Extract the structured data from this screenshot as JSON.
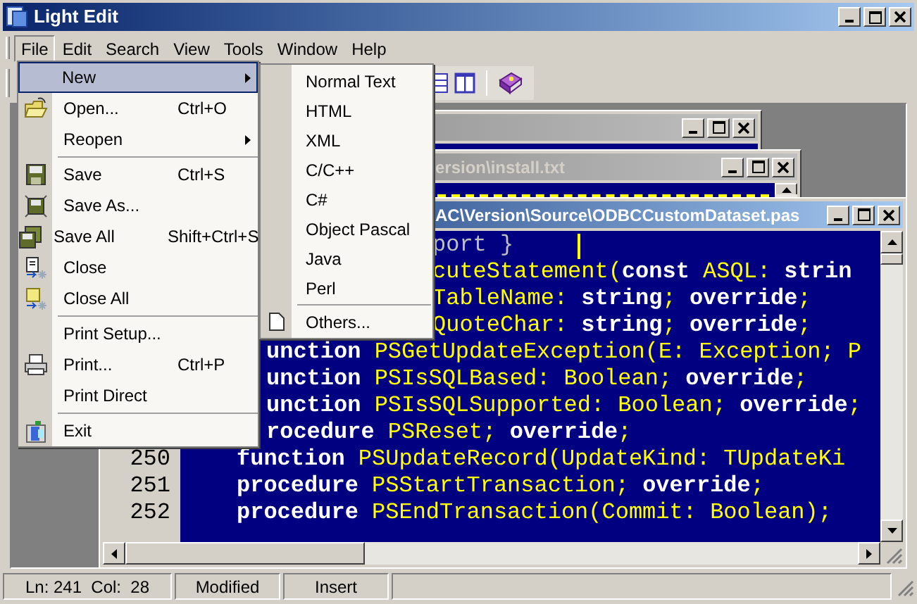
{
  "window": {
    "title": "Light Edit"
  },
  "menubar": [
    {
      "label": "File",
      "selected": true
    },
    {
      "label": "Edit",
      "selected": false
    },
    {
      "label": "Search",
      "selected": false
    },
    {
      "label": "View",
      "selected": false
    },
    {
      "label": "Tools",
      "selected": false
    },
    {
      "label": "Window",
      "selected": false
    },
    {
      "label": "Help",
      "selected": false
    }
  ],
  "file_menu": [
    {
      "kind": "item",
      "label": "New",
      "has_submenu": true,
      "selected": true
    },
    {
      "kind": "item",
      "label": "Open...",
      "shortcut": "Ctrl+O",
      "selected": false
    },
    {
      "kind": "item",
      "label": "Reopen",
      "has_submenu": true,
      "selected": false
    },
    {
      "kind": "separator"
    },
    {
      "kind": "item",
      "label": "Save",
      "shortcut": "Ctrl+S",
      "selected": false
    },
    {
      "kind": "item",
      "label": "Save As...",
      "selected": false
    },
    {
      "kind": "item",
      "label": "Save All",
      "shortcut": "Shift+Ctrl+S",
      "selected": false
    },
    {
      "kind": "item",
      "label": "Close",
      "selected": false
    },
    {
      "kind": "item",
      "label": "Close All",
      "selected": false
    },
    {
      "kind": "separator"
    },
    {
      "kind": "item",
      "label": "Print Setup...",
      "selected": false
    },
    {
      "kind": "item",
      "label": "Print...",
      "shortcut": "Ctrl+P",
      "selected": false
    },
    {
      "kind": "item",
      "label": "Print Direct",
      "selected": false
    },
    {
      "kind": "separator"
    },
    {
      "kind": "item",
      "label": "Exit",
      "selected": false
    }
  ],
  "new_submenu": [
    {
      "kind": "item",
      "label": "Normal Text"
    },
    {
      "kind": "item",
      "label": "HTML"
    },
    {
      "kind": "item",
      "label": "XML"
    },
    {
      "kind": "item",
      "label": "C/C++"
    },
    {
      "kind": "item",
      "label": "C#"
    },
    {
      "kind": "item",
      "label": "Object Pascal"
    },
    {
      "kind": "item",
      "label": "Java"
    },
    {
      "kind": "item",
      "label": "Perl"
    },
    {
      "kind": "separator"
    },
    {
      "kind": "item",
      "label": "Others..."
    }
  ],
  "documents": [
    {
      "active": false
    },
    {
      "title": "ersion\\install.txt",
      "active": false
    },
    {
      "title": "AC\\Version\\Source\\ODBCCustomDataset.pas",
      "active": true
    }
  ],
  "editor": {
    "lines": [
      {
        "segments": [
          {
            "kind": "comment",
            "text": "port }"
          }
        ]
      },
      {
        "segments": [
          {
            "kind": "ident",
            "text": "cuteStatement("
          },
          {
            "kind": "keyword",
            "text": "const"
          },
          {
            "kind": "ident",
            "text": " ASQL: "
          },
          {
            "kind": "keyword",
            "text": "strin"
          }
        ]
      },
      {
        "segments": [
          {
            "kind": "ident",
            "text": "TableName: "
          },
          {
            "kind": "keyword",
            "text": "string"
          },
          {
            "kind": "ident",
            "text": "; "
          },
          {
            "kind": "keyword",
            "text": "override"
          },
          {
            "kind": "ident",
            "text": ";"
          }
        ]
      },
      {
        "segments": [
          {
            "kind": "ident",
            "text": "QuoteChar: "
          },
          {
            "kind": "keyword",
            "text": "string"
          },
          {
            "kind": "ident",
            "text": "; "
          },
          {
            "kind": "keyword",
            "text": "override"
          },
          {
            "kind": "ident",
            "text": ";"
          }
        ]
      },
      {
        "segments": [
          {
            "kind": "keyword",
            "text": "unction"
          },
          {
            "kind": "ident",
            "text": " PSGetUpdateException(E: Exception; P"
          }
        ]
      },
      {
        "segments": [
          {
            "kind": "keyword",
            "text": "unction"
          },
          {
            "kind": "ident",
            "text": " PSIsSQLBased: Boolean; "
          },
          {
            "kind": "keyword",
            "text": "override"
          },
          {
            "kind": "ident",
            "text": ";"
          }
        ]
      },
      {
        "segments": [
          {
            "kind": "keyword",
            "text": "unction"
          },
          {
            "kind": "ident",
            "text": " PSIsSQLSupported: Boolean; "
          },
          {
            "kind": "keyword",
            "text": "override"
          },
          {
            "kind": "ident",
            "text": ";"
          }
        ]
      },
      {
        "segments": [
          {
            "kind": "keyword",
            "text": "rocedure"
          },
          {
            "kind": "ident",
            "text": " PSReset; "
          },
          {
            "kind": "keyword",
            "text": "override"
          },
          {
            "kind": "ident",
            "text": ";"
          }
        ]
      },
      {
        "number": "250",
        "segments": [
          {
            "kind": "keyword",
            "text": "function"
          },
          {
            "kind": "ident",
            "text": " PSUpdateRecord(UpdateKind: TUpdateKi"
          }
        ]
      },
      {
        "number": "251",
        "segments": [
          {
            "kind": "keyword",
            "text": "procedure"
          },
          {
            "kind": "ident",
            "text": " PSStartTransaction; "
          },
          {
            "kind": "keyword",
            "text": "override"
          },
          {
            "kind": "ident",
            "text": ";"
          }
        ]
      },
      {
        "number": "252",
        "segments": [
          {
            "kind": "keyword",
            "text": "procedure"
          },
          {
            "kind": "ident",
            "text": " PSEndTransaction(Commit: Boolean);"
          }
        ]
      }
    ]
  },
  "status_bar": [
    "Ln: 241  Col:  28",
    "Modified",
    "Insert"
  ]
}
